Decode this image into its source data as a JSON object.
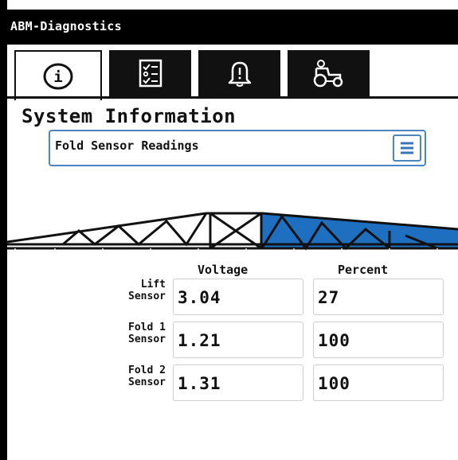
{
  "app": {
    "title": "ABM-Diagnostics"
  },
  "tabs": [
    {
      "name": "info-icon",
      "active": true
    },
    {
      "name": "checklist-icon",
      "active": false
    },
    {
      "name": "bell-icon",
      "active": false
    },
    {
      "name": "tractor-icon",
      "active": false
    }
  ],
  "page": {
    "title": "System Information"
  },
  "dropdown": {
    "selected": "Fold Sensor Readings",
    "icon": "menu-icon"
  },
  "table": {
    "headers": {
      "voltage": "Voltage",
      "percent": "Percent"
    },
    "rows": [
      {
        "label_line1": "Lift",
        "label_line2": "Sensor",
        "voltage": "3.04",
        "percent": "27"
      },
      {
        "label_line1": "Fold 1",
        "label_line2": "Sensor",
        "voltage": "1.21",
        "percent": "100"
      },
      {
        "label_line1": "Fold 2",
        "label_line2": "Sensor",
        "voltage": "1.31",
        "percent": "100"
      }
    ]
  },
  "colors": {
    "accent": "#4a86c5",
    "boom_highlight": "#1f6fc0"
  }
}
